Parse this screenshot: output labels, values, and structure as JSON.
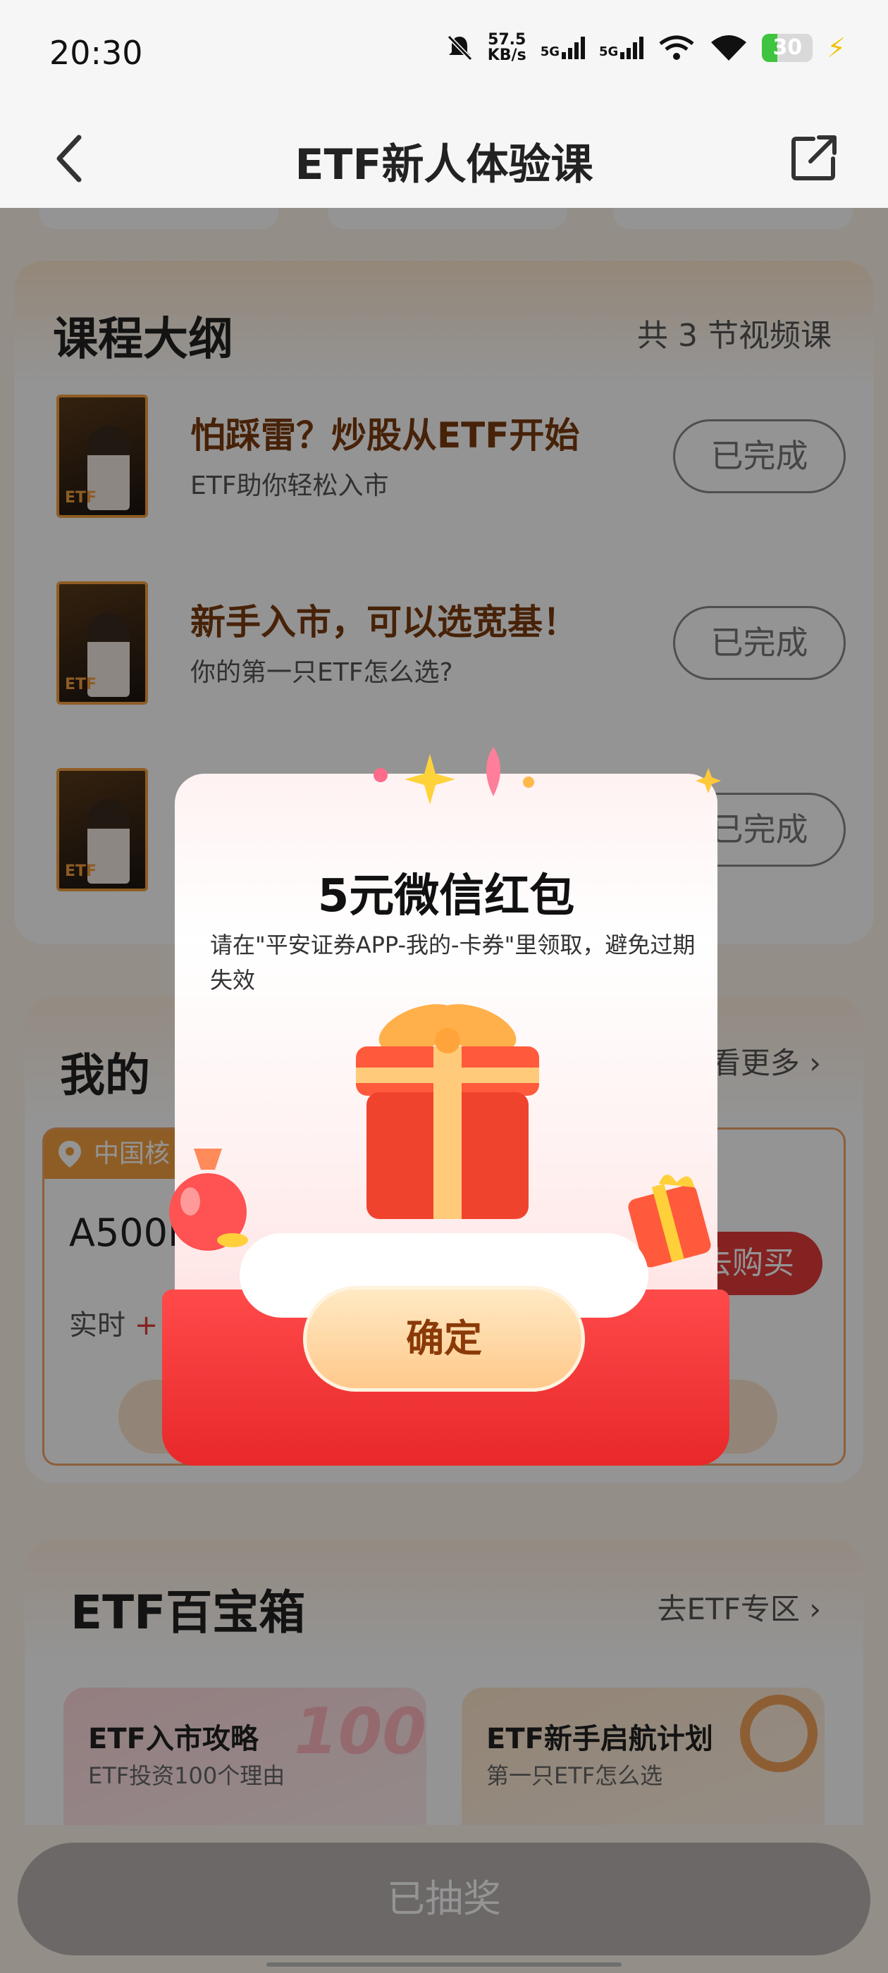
{
  "status_bar": {
    "time": "20:30",
    "net_speed_value": "57.5",
    "net_speed_unit": "KB/s",
    "signal_1": "5G",
    "signal_2": "5G",
    "battery": "30"
  },
  "header": {
    "title": "ETF新人体验课"
  },
  "outline": {
    "title": "课程大纲",
    "subtitle": "共 3 节视频课",
    "lessons": [
      {
        "title": "怕踩雷？炒股从ETF开始",
        "desc": "ETF助你轻松入市",
        "status": "已完成",
        "thumb_tag": "ETF"
      },
      {
        "title": "新手入市，可以选宽基！",
        "desc": "你的第一只ETF怎么选?",
        "status": "已完成",
        "thumb_tag": "ETF"
      },
      {
        "title": "",
        "desc": "",
        "status": "已完成",
        "thumb_tag": "ETF"
      }
    ]
  },
  "my_section": {
    "title": "我的",
    "more": "看更多",
    "fund_tag": "中国核",
    "fund_name": "A500E",
    "realtime": "实时",
    "buy": "去购买"
  },
  "toolbox": {
    "title": "ETF百宝箱",
    "more": "去ETF专区",
    "tools": [
      {
        "title": "ETF入市攻略",
        "desc": "ETF投资100个理由",
        "badge": "100"
      },
      {
        "title": "ETF新手启航计划",
        "desc": "第一只ETF怎么选"
      }
    ]
  },
  "bottom": {
    "lottery": "已抽奖"
  },
  "modal": {
    "title": "5元微信红包",
    "desc": "请在\"平安证券APP-我的-卡券\"里领取，避免过期失效",
    "confirm": "确定"
  },
  "colors": {
    "accent_orange": "#f5852b",
    "brand_red": "#e8282a",
    "lesson_title": "#7a3b0e"
  },
  "icons": {
    "back": "chevron-left-icon",
    "share": "share-icon",
    "gift": "gift-icon",
    "location": "location-pin-icon"
  }
}
